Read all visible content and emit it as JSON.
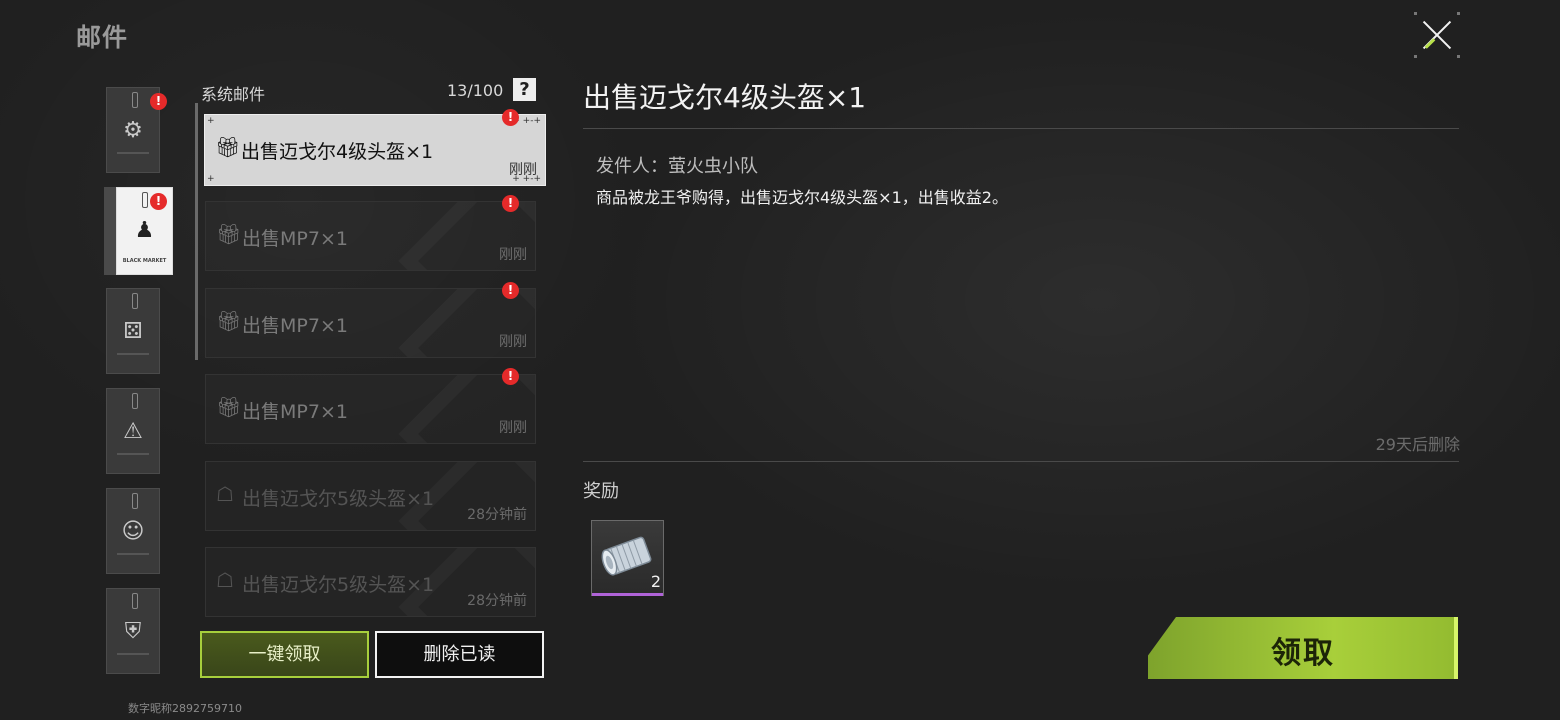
{
  "page": {
    "title": "邮件",
    "footer_id": "数字昵称2892759710"
  },
  "categories": [
    {
      "icon": "gear-icon",
      "glyph": "⚙",
      "unread": true
    },
    {
      "icon": "black-market-icon",
      "glyph": "♟",
      "unread": true,
      "caption": "BLACK MARKET",
      "selected": true
    },
    {
      "icon": "dice-icon",
      "glyph": "⚄",
      "unread": false
    },
    {
      "icon": "warning-icon",
      "glyph": "⚠",
      "unread": false
    },
    {
      "icon": "character-icon",
      "glyph": "☺",
      "unread": false
    },
    {
      "icon": "vest-icon",
      "glyph": "⛨",
      "unread": false
    }
  ],
  "mail_list": {
    "header": "系统邮件",
    "count": "13/100",
    "help_label": "?",
    "items": [
      {
        "title": "出售迈戈尔4级头盔×1",
        "time": "刚刚",
        "icon": "gift-icon",
        "unread": true,
        "selected": true
      },
      {
        "title": "出售MP7×1",
        "time": "刚刚",
        "icon": "gift-icon",
        "unread": true
      },
      {
        "title": "出售MP7×1",
        "time": "刚刚",
        "icon": "gift-icon",
        "unread": true
      },
      {
        "title": "出售MP7×1",
        "time": "刚刚",
        "icon": "gift-icon",
        "unread": true
      },
      {
        "title": "出售迈戈尔5级头盔×1",
        "time": "28分钟前",
        "icon": "gift-open-icon",
        "unread": false
      },
      {
        "title": "出售迈戈尔5级头盔×1",
        "time": "28分钟前",
        "icon": "gift-open-icon",
        "unread": false
      }
    ],
    "claim_all_label": "一键领取",
    "delete_read_label": "删除已读"
  },
  "detail": {
    "title": "出售迈戈尔4级头盔×1",
    "sender": "发件人：萤火虫小队",
    "body": "商品被龙王爷购得，出售迈戈尔4级头盔×1，出售收益2。",
    "expiry": "29天后删除",
    "rewards_label": "奖励",
    "reward": {
      "icon": "cash-roll-icon",
      "quantity": "2"
    },
    "claim_label": "领取"
  },
  "colors": {
    "accent": "#a8cf3a",
    "unread_badge": "#e52a2a",
    "rarity": "#b063d8"
  }
}
